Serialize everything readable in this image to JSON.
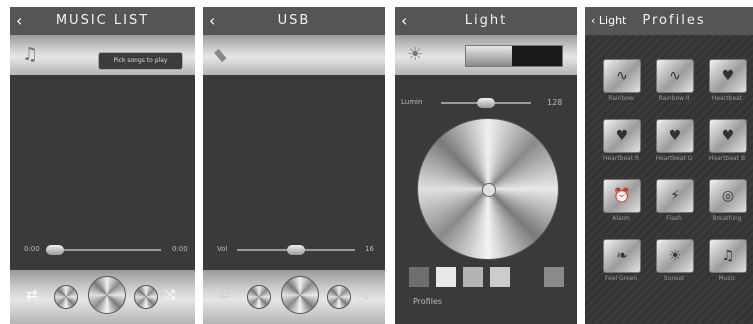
{
  "music_list": {
    "title": "MUSIC LIST",
    "pick_button": "Pick songs to play",
    "time_start": "0:00",
    "time_end": "0:00"
  },
  "usb": {
    "title": "USB",
    "vol_label": "Vol",
    "vol_value": "16"
  },
  "light": {
    "title": "Light",
    "lumin_label": "Lumin",
    "lumin_value": "128",
    "profiles_label": "Profiles",
    "swatch_colors": [
      "#6e6e6e",
      "#e8e8e8",
      "#b4b4b4",
      "#cccccc",
      "#3a3a3a",
      "#8a8a8a"
    ]
  },
  "profiles": {
    "back_label": "Light",
    "title": "Profiles",
    "items": [
      {
        "label": "Rainbow",
        "icon": "swirl-icon"
      },
      {
        "label": "Rainbow II",
        "icon": "swirl-icon"
      },
      {
        "label": "Heartbeat",
        "icon": "heart-pulse-icon"
      },
      {
        "label": "Heartbeat R",
        "icon": "heart-pulse-icon"
      },
      {
        "label": "Heartbeat G",
        "icon": "heart-pulse-icon"
      },
      {
        "label": "Heartbeat B",
        "icon": "heart-pulse-icon"
      },
      {
        "label": "Alarm",
        "icon": "alarm-icon"
      },
      {
        "label": "Flash",
        "icon": "flash-icon"
      },
      {
        "label": "Breathing",
        "icon": "breathing-icon"
      },
      {
        "label": "Feel Green",
        "icon": "leaf-icon"
      },
      {
        "label": "Sunset",
        "icon": "sunset-icon"
      },
      {
        "label": "Music",
        "icon": "music-note-icon"
      }
    ]
  }
}
